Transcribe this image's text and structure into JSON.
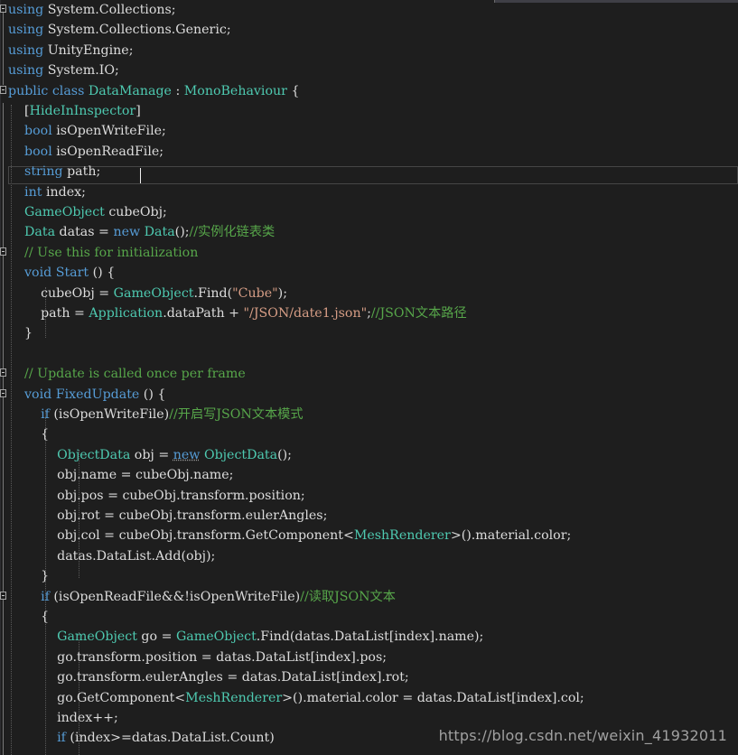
{
  "editor": {
    "lines": [
      {
        "tokens": [
          {
            "t": "using",
            "c": "kw"
          },
          {
            "t": " System.Collections;",
            "c": "plain"
          }
        ],
        "fold": true
      },
      {
        "tokens": [
          {
            "t": "using",
            "c": "kw"
          },
          {
            "t": " System.Collections.Generic;",
            "c": "plain"
          }
        ]
      },
      {
        "tokens": [
          {
            "t": "using",
            "c": "kw"
          },
          {
            "t": " UnityEngine;",
            "c": "plain"
          }
        ]
      },
      {
        "tokens": [
          {
            "t": "using",
            "c": "kw"
          },
          {
            "t": " System.IO;",
            "c": "plain"
          }
        ]
      },
      {
        "tokens": [
          {
            "t": "public",
            "c": "kw"
          },
          {
            "t": " ",
            "c": "plain"
          },
          {
            "t": "class",
            "c": "kw"
          },
          {
            "t": " ",
            "c": "plain"
          },
          {
            "t": "DataManage",
            "c": "type"
          },
          {
            "t": " : ",
            "c": "plain"
          },
          {
            "t": "MonoBehaviour",
            "c": "type"
          },
          {
            "t": " {",
            "c": "plain"
          }
        ],
        "fold": true
      },
      {
        "tokens": [
          {
            "t": "    [",
            "c": "plain"
          },
          {
            "t": "HideInInspector",
            "c": "type"
          },
          {
            "t": "]",
            "c": "plain"
          }
        ]
      },
      {
        "tokens": [
          {
            "t": "    ",
            "c": "plain"
          },
          {
            "t": "bool",
            "c": "kw"
          },
          {
            "t": " isOpenWriteFile;",
            "c": "plain"
          }
        ]
      },
      {
        "tokens": [
          {
            "t": "    ",
            "c": "plain"
          },
          {
            "t": "bool",
            "c": "kw"
          },
          {
            "t": " isOpenReadFile;",
            "c": "plain"
          }
        ]
      },
      {
        "tokens": [
          {
            "t": "    ",
            "c": "plain"
          },
          {
            "t": "string",
            "c": "kw"
          },
          {
            "t": " path;",
            "c": "plain"
          }
        ],
        "current": true
      },
      {
        "tokens": [
          {
            "t": "    ",
            "c": "plain"
          },
          {
            "t": "int",
            "c": "kw"
          },
          {
            "t": " index;",
            "c": "plain"
          }
        ]
      },
      {
        "tokens": [
          {
            "t": "    ",
            "c": "plain"
          },
          {
            "t": "GameObject",
            "c": "type"
          },
          {
            "t": " cubeObj;",
            "c": "plain"
          }
        ]
      },
      {
        "tokens": [
          {
            "t": "    ",
            "c": "plain"
          },
          {
            "t": "Data",
            "c": "type"
          },
          {
            "t": " datas = ",
            "c": "plain"
          },
          {
            "t": "new",
            "c": "kw"
          },
          {
            "t": " ",
            "c": "plain"
          },
          {
            "t": "Data",
            "c": "type"
          },
          {
            "t": "();",
            "c": "plain"
          },
          {
            "t": "//实例化链表类",
            "c": "cm"
          }
        ]
      },
      {
        "tokens": [
          {
            "t": "    ",
            "c": "plain"
          },
          {
            "t": "// Use this for initialization",
            "c": "cm"
          }
        ],
        "fold": true
      },
      {
        "tokens": [
          {
            "t": "    ",
            "c": "plain"
          },
          {
            "t": "void",
            "c": "kw"
          },
          {
            "t": " ",
            "c": "plain"
          },
          {
            "t": "Start",
            "c": "kw"
          },
          {
            "t": " () {",
            "c": "plain"
          }
        ]
      },
      {
        "tokens": [
          {
            "t": "        cubeObj = ",
            "c": "plain"
          },
          {
            "t": "GameObject",
            "c": "type"
          },
          {
            "t": ".Find(",
            "c": "plain"
          },
          {
            "t": "\"Cube\"",
            "c": "str"
          },
          {
            "t": ");",
            "c": "plain"
          }
        ]
      },
      {
        "tokens": [
          {
            "t": "        path = ",
            "c": "plain"
          },
          {
            "t": "Application",
            "c": "type"
          },
          {
            "t": ".dataPath + ",
            "c": "plain"
          },
          {
            "t": "\"/JSON/date1.json\"",
            "c": "str"
          },
          {
            "t": ";",
            "c": "plain"
          },
          {
            "t": "//JSON文本路径",
            "c": "cm"
          }
        ]
      },
      {
        "tokens": [
          {
            "t": "    }",
            "c": "plain"
          }
        ]
      },
      {
        "tokens": []
      },
      {
        "tokens": [
          {
            "t": "    ",
            "c": "plain"
          },
          {
            "t": "// Update is called once per frame",
            "c": "cm"
          }
        ],
        "fold": true
      },
      {
        "tokens": [
          {
            "t": "    ",
            "c": "plain"
          },
          {
            "t": "void",
            "c": "kw"
          },
          {
            "t": " ",
            "c": "plain"
          },
          {
            "t": "FixedUpdate",
            "c": "kw"
          },
          {
            "t": " () {",
            "c": "plain"
          }
        ],
        "fold": true
      },
      {
        "tokens": [
          {
            "t": "        ",
            "c": "plain"
          },
          {
            "t": "if",
            "c": "kw"
          },
          {
            "t": " (isOpenWriteFile)",
            "c": "plain"
          },
          {
            "t": "//开启写JSON文本模式",
            "c": "cm"
          }
        ]
      },
      {
        "tokens": [
          {
            "t": "        {",
            "c": "plain"
          }
        ]
      },
      {
        "tokens": [
          {
            "t": "            ",
            "c": "plain"
          },
          {
            "t": "ObjectData",
            "c": "type"
          },
          {
            "t": " obj = ",
            "c": "plain"
          },
          {
            "t": "new",
            "c": "kw",
            "squiggle": true
          },
          {
            "t": " ",
            "c": "plain"
          },
          {
            "t": "ObjectData",
            "c": "type"
          },
          {
            "t": "();",
            "c": "plain"
          }
        ]
      },
      {
        "tokens": [
          {
            "t": "            obj.name = cubeObj.name;",
            "c": "plain"
          }
        ]
      },
      {
        "tokens": [
          {
            "t": "            obj.pos = cubeObj.transform.position;",
            "c": "plain"
          }
        ]
      },
      {
        "tokens": [
          {
            "t": "            obj.rot = cubeObj.transform.eulerAngles;",
            "c": "plain"
          }
        ]
      },
      {
        "tokens": [
          {
            "t": "            obj.col = cubeObj.transform.GetComponent<",
            "c": "plain"
          },
          {
            "t": "MeshRenderer",
            "c": "type"
          },
          {
            "t": ">().material.color;",
            "c": "plain"
          }
        ]
      },
      {
        "tokens": [
          {
            "t": "            datas.DataList.Add(obj);",
            "c": "plain"
          }
        ]
      },
      {
        "tokens": [
          {
            "t": "        }",
            "c": "plain"
          }
        ]
      },
      {
        "tokens": [
          {
            "t": "        ",
            "c": "plain"
          },
          {
            "t": "if",
            "c": "kw"
          },
          {
            "t": " (isOpenReadFile&&!isOpenWriteFile)",
            "c": "plain"
          },
          {
            "t": "//读取JSON文本",
            "c": "cm"
          }
        ],
        "fold": true
      },
      {
        "tokens": [
          {
            "t": "        {",
            "c": "plain"
          }
        ]
      },
      {
        "tokens": [
          {
            "t": "            ",
            "c": "plain"
          },
          {
            "t": "GameObject",
            "c": "type"
          },
          {
            "t": " go = ",
            "c": "plain"
          },
          {
            "t": "GameObject",
            "c": "type"
          },
          {
            "t": ".Find(datas.DataList[index].name);",
            "c": "plain"
          }
        ]
      },
      {
        "tokens": [
          {
            "t": "            go.transform.position = datas.DataList[index].pos;",
            "c": "plain"
          }
        ]
      },
      {
        "tokens": [
          {
            "t": "            go.transform.eulerAngles = datas.DataList[index].rot;",
            "c": "plain"
          }
        ]
      },
      {
        "tokens": [
          {
            "t": "            go.GetComponent<",
            "c": "plain"
          },
          {
            "t": "MeshRenderer",
            "c": "type"
          },
          {
            "t": ">().material.color = datas.DataList[index].col;",
            "c": "plain"
          }
        ]
      },
      {
        "tokens": [
          {
            "t": "            index++;",
            "c": "plain"
          }
        ]
      },
      {
        "tokens": [
          {
            "t": "            ",
            "c": "plain"
          },
          {
            "t": "if",
            "c": "kw"
          },
          {
            "t": " (index>=datas.DataList.Count)",
            "c": "plain"
          }
        ]
      }
    ]
  },
  "colors": {
    "background": "#1e1e1e",
    "keyword": "#569cd6",
    "type": "#4ec9b0",
    "string": "#d69d85",
    "comment": "#57a64a",
    "text": "#dcdcdc"
  },
  "watermark": "https://blog.csdn.net/weixin_41932011"
}
